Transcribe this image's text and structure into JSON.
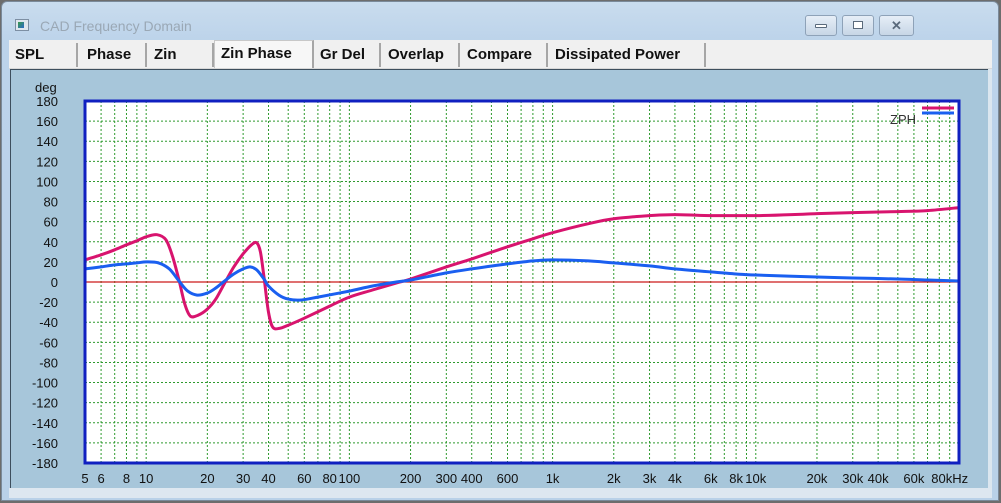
{
  "window": {
    "title": "CAD Frequency Domain",
    "controls": [
      "minimize",
      "maximize",
      "close"
    ]
  },
  "tabs": [
    {
      "label": "SPL",
      "active": false
    },
    {
      "label": "Phase",
      "active": false
    },
    {
      "label": "Zin",
      "active": false
    },
    {
      "label": "Zin Phase",
      "active": true
    },
    {
      "label": "Gr Del",
      "active": false
    },
    {
      "label": "Overlap",
      "active": false
    },
    {
      "label": "Compare",
      "active": false
    },
    {
      "label": "Dissipated Power",
      "active": false
    }
  ],
  "colors": {
    "series1": "#d8146e",
    "series2": "#1a5ff0",
    "zero_line": "#cc1a1a",
    "grid": "#2e9a2e",
    "plot_border": "#1020c0",
    "panel_bg": "#a7c6da"
  },
  "chart_data": {
    "type": "line",
    "title": "",
    "xlabel": "",
    "ylabel": "deg",
    "x_scale": "log",
    "xlim": [
      5,
      100000
    ],
    "ylim": [
      -180,
      180
    ],
    "grid": true,
    "legend": {
      "label": "ZPH",
      "position": "top-right"
    },
    "y_ticks": [
      180,
      160,
      140,
      120,
      100,
      80,
      60,
      40,
      20,
      0,
      -20,
      -40,
      -60,
      -80,
      -100,
      -120,
      -140,
      -160,
      -180
    ],
    "x_ticks": [
      {
        "value": 5,
        "label": "5"
      },
      {
        "value": 6,
        "label": "6"
      },
      {
        "value": 8,
        "label": "8"
      },
      {
        "value": 10,
        "label": "10"
      },
      {
        "value": 20,
        "label": "20"
      },
      {
        "value": 30,
        "label": "30"
      },
      {
        "value": 40,
        "label": "40"
      },
      {
        "value": 60,
        "label": "60"
      },
      {
        "value": 80,
        "label": "80"
      },
      {
        "value": 100,
        "label": "100"
      },
      {
        "value": 200,
        "label": "200"
      },
      {
        "value": 300,
        "label": "300"
      },
      {
        "value": 400,
        "label": "400"
      },
      {
        "value": 600,
        "label": "600"
      },
      {
        "value": 1000,
        "label": "1k"
      },
      {
        "value": 2000,
        "label": "2k"
      },
      {
        "value": 3000,
        "label": "3k"
      },
      {
        "value": 4000,
        "label": "4k"
      },
      {
        "value": 6000,
        "label": "6k"
      },
      {
        "value": 8000,
        "label": "8k"
      },
      {
        "value": 10000,
        "label": "10k"
      },
      {
        "value": 20000,
        "label": "20k"
      },
      {
        "value": 30000,
        "label": "30k"
      },
      {
        "value": 40000,
        "label": "40k"
      },
      {
        "value": 60000,
        "label": "60k"
      },
      {
        "value": 80000,
        "label": "80kHz"
      }
    ],
    "x_gridlines": [
      5,
      6,
      7,
      8,
      9,
      10,
      20,
      30,
      40,
      50,
      60,
      70,
      80,
      90,
      100,
      200,
      300,
      400,
      500,
      600,
      700,
      800,
      900,
      1000,
      2000,
      3000,
      4000,
      5000,
      6000,
      7000,
      8000,
      9000,
      10000,
      20000,
      30000,
      40000,
      50000,
      60000,
      70000,
      80000,
      90000
    ],
    "series": [
      {
        "name": "ZPH (magenta)",
        "color": "#d8146e",
        "x": [
          5,
          6,
          7,
          8,
          9,
          10,
          11.3,
          12.5,
          13.5,
          14.5,
          15.5,
          16.5,
          18,
          20,
          22,
          24.5,
          27,
          30,
          33,
          35,
          36.5,
          38,
          40,
          42,
          45.5,
          50,
          60,
          80,
          100,
          130,
          170,
          200,
          300,
          400,
          600,
          800,
          1000,
          1500,
          2000,
          3000,
          4000,
          6000,
          8000,
          10000,
          15000,
          20000,
          30000,
          50000,
          70000,
          100000
        ],
        "y": [
          22,
          27,
          32,
          37,
          41,
          45,
          47,
          42,
          25,
          2,
          -22,
          -34,
          -33,
          -27,
          -17,
          0,
          15,
          28,
          37,
          39,
          30,
          5,
          -30,
          -45,
          -46,
          -43,
          -36,
          -24,
          -15,
          -8,
          -1,
          3,
          15,
          23,
          35,
          43,
          49,
          58,
          63,
          66,
          67,
          66,
          66,
          66,
          67,
          68,
          69,
          70,
          71,
          74
        ]
      },
      {
        "name": "ZPH (blue)",
        "color": "#1a5ff0",
        "x": [
          5,
          6,
          7,
          8,
          9,
          10,
          11.5,
          13,
          14.5,
          16,
          17.8,
          20,
          22,
          24,
          27,
          30,
          32.5,
          35,
          38,
          40,
          45,
          50,
          57,
          70,
          100,
          130,
          170,
          200,
          300,
          400,
          600,
          800,
          1000,
          1500,
          2000,
          3000,
          4000,
          6000,
          8000,
          10000,
          20000,
          30000,
          50000,
          70000,
          100000
        ],
        "y": [
          13,
          15,
          17,
          18,
          19,
          20,
          19,
          13,
          1,
          -9,
          -13,
          -11,
          -6,
          0,
          8,
          13,
          15,
          12,
          3,
          -4,
          -13,
          -17,
          -18,
          -15,
          -9,
          -4,
          0,
          2,
          9,
          13,
          18,
          21,
          22,
          21,
          19,
          16,
          13,
          10,
          8,
          7,
          5,
          4,
          3,
          2,
          1
        ]
      }
    ]
  }
}
